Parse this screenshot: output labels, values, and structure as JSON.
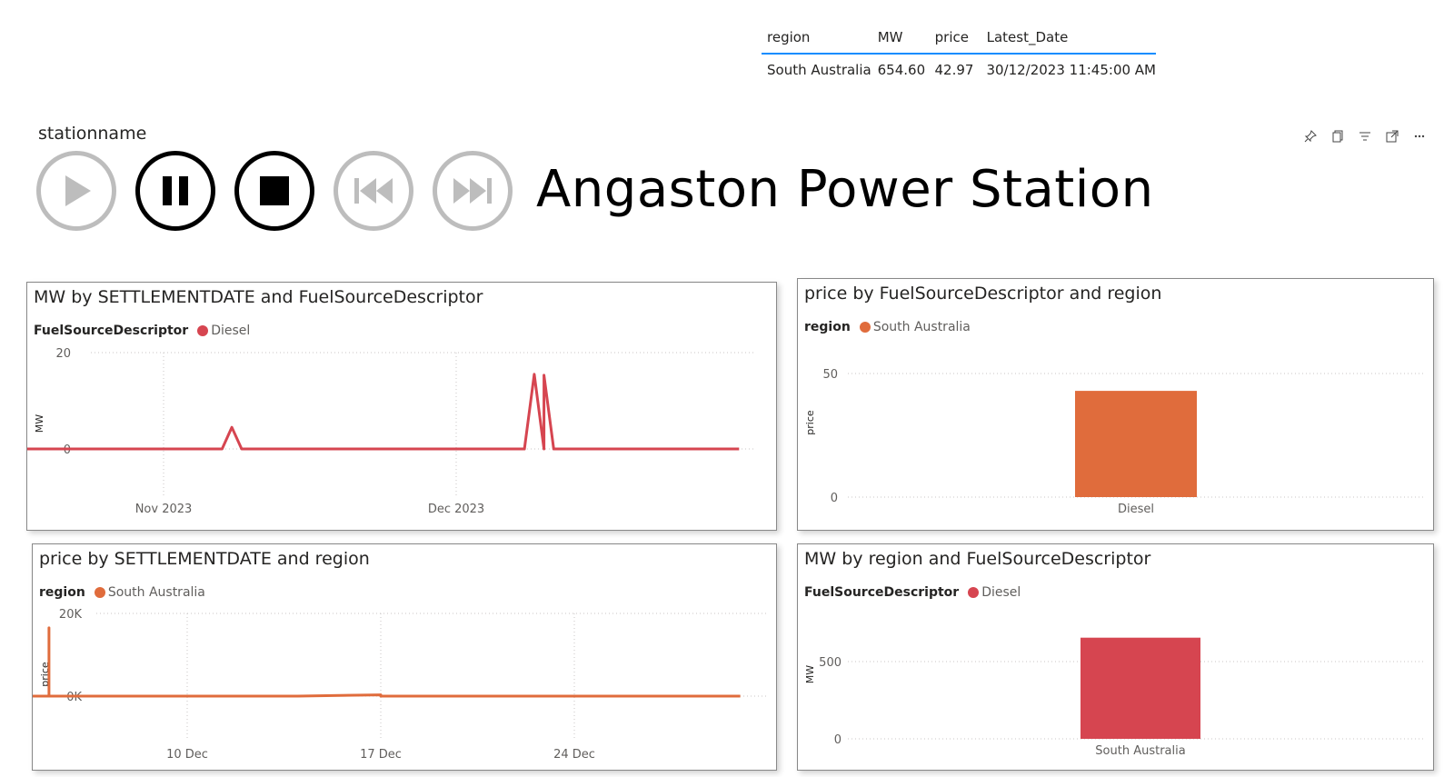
{
  "table": {
    "headers": [
      "region",
      "MW",
      "price",
      "Latest_Date"
    ],
    "row": [
      "South Australia",
      "654.60",
      "42.97",
      "30/12/2023 11:45:00 AM"
    ]
  },
  "slicer": {
    "title": "stationname",
    "value": "Angaston Power Station",
    "buttons": [
      "play",
      "pause",
      "stop",
      "previous",
      "next"
    ]
  },
  "colors": {
    "diesel": "#d64550",
    "south_australia": "#e06c3c"
  },
  "visual_header_icons": [
    "pin-icon",
    "copy-icon",
    "filter-icon",
    "focus-mode-icon",
    "more-options-icon"
  ],
  "charts": {
    "mw_line": {
      "title": "MW by SETTLEMENTDATE and FuelSourceDescriptor",
      "legend_title": "FuelSourceDescriptor",
      "legend_item": "Diesel",
      "ylabel": "MW",
      "yticks": [
        "20",
        "0"
      ],
      "xticks": [
        "Nov 2023",
        "Dec 2023"
      ]
    },
    "price_bar": {
      "title": "price by FuelSourceDescriptor and region",
      "legend_title": "region",
      "legend_item": "South Australia",
      "ylabel": "price",
      "yticks": [
        "50",
        "0"
      ],
      "category": "Diesel"
    },
    "price_line": {
      "title": "price by SETTLEMENTDATE and region",
      "legend_title": "region",
      "legend_item": "South Australia",
      "ylabel": "price",
      "yticks": [
        "20K",
        "0K"
      ],
      "xticks": [
        "10 Dec",
        "17 Dec",
        "24 Dec"
      ]
    },
    "mw_bar": {
      "title": "MW by region and FuelSourceDescriptor",
      "legend_title": "FuelSourceDescriptor",
      "legend_item": "Diesel",
      "ylabel": "MW",
      "yticks": [
        "500",
        "0"
      ],
      "category": "South Australia"
    }
  },
  "chart_data": [
    {
      "type": "line",
      "title": "MW by SETTLEMENTDATE and FuelSourceDescriptor",
      "ylabel": "MW",
      "ylim": [
        0,
        20
      ],
      "series": [
        {
          "name": "Diesel",
          "points": [
            [
              "2023-10-12",
              0
            ],
            [
              "2023-11-07",
              0
            ],
            [
              "2023-11-08",
              4.5
            ],
            [
              "2023-11-09",
              0
            ],
            [
              "2023-12-08",
              0
            ],
            [
              "2023-12-09",
              15.5
            ],
            [
              "2023-12-10",
              0
            ],
            [
              "2023-12-10",
              15.3
            ],
            [
              "2023-12-11",
              0
            ],
            [
              "2023-12-30",
              0
            ]
          ]
        }
      ]
    },
    {
      "type": "bar",
      "title": "price by FuelSourceDescriptor and region",
      "ylabel": "price",
      "ylim": [
        0,
        50
      ],
      "categories": [
        "Diesel"
      ],
      "series": [
        {
          "name": "South Australia",
          "values": [
            42.97
          ]
        }
      ]
    },
    {
      "type": "line",
      "title": "price by SETTLEMENTDATE and region",
      "ylabel": "price",
      "ylim": [
        0,
        20000
      ],
      "series": [
        {
          "name": "South Australia",
          "points": [
            [
              "2023-12-03",
              0
            ],
            [
              "2023-12-05",
              0
            ],
            [
              "2023-12-05",
              16500
            ],
            [
              "2023-12-05",
              0
            ],
            [
              "2023-12-14",
              0
            ],
            [
              "2023-12-17",
              300
            ],
            [
              "2023-12-17",
              0
            ],
            [
              "2023-12-30",
              0
            ]
          ]
        }
      ]
    },
    {
      "type": "bar",
      "title": "MW by region and FuelSourceDescriptor",
      "ylabel": "MW",
      "ylim": [
        0,
        654.6
      ],
      "categories": [
        "South Australia"
      ],
      "series": [
        {
          "name": "Diesel",
          "values": [
            654.6
          ]
        }
      ]
    }
  ]
}
